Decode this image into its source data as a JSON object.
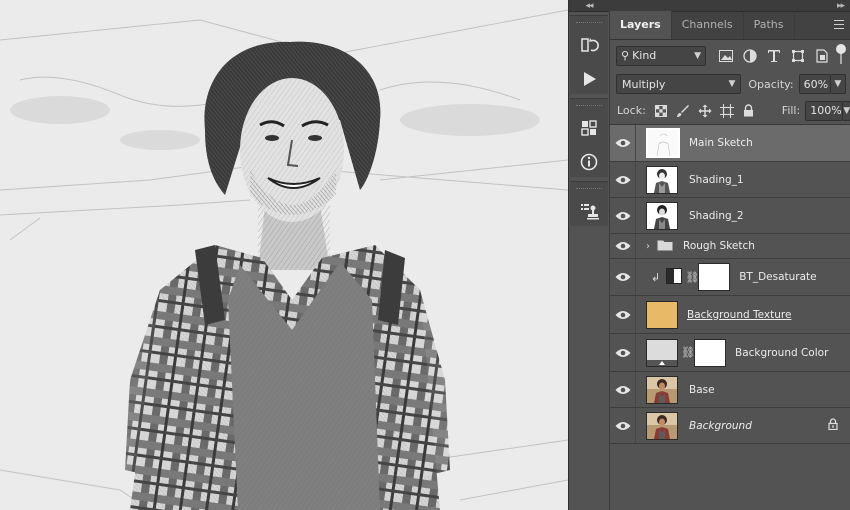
{
  "top_bar": {
    "collapse_glyph": "◂◂"
  },
  "tools": [
    {
      "name": "history-brush-icon"
    },
    {
      "name": "play-actions-icon"
    },
    {
      "name": "libraries-icon"
    },
    {
      "name": "info-icon"
    },
    {
      "name": "stamp-clone-icon"
    }
  ],
  "panel": {
    "collapse_glyph": "▸▸",
    "tabs": [
      {
        "label": "Layers",
        "active": true
      },
      {
        "label": "Channels",
        "active": false
      },
      {
        "label": "Paths",
        "active": false
      }
    ],
    "filter": {
      "label": "Kind",
      "search_glyph": "⚲"
    },
    "blend_mode": "Multiply",
    "opacity_label": "Opacity:",
    "opacity_value": "60%",
    "lock_label": "Lock:",
    "fill_label": "Fill:",
    "fill_value": "100%"
  },
  "layers": [
    {
      "name": "Main Sketch",
      "selected": true,
      "kind": "pixel-sketch",
      "italic": false,
      "underline": false
    },
    {
      "name": "Shading_1",
      "selected": false,
      "kind": "pixel-person",
      "italic": false,
      "underline": false
    },
    {
      "name": "Shading_2",
      "selected": false,
      "kind": "pixel-person",
      "italic": false,
      "underline": false
    },
    {
      "name": "Rough Sketch",
      "selected": false,
      "kind": "group",
      "italic": false,
      "underline": false
    },
    {
      "name": "BT_Desaturate",
      "selected": false,
      "kind": "adjustment",
      "italic": false,
      "underline": false
    },
    {
      "name": "Background Texture",
      "selected": false,
      "kind": "fill-color",
      "color": "#e8b967",
      "italic": false,
      "underline": true
    },
    {
      "name": "Background Color",
      "selected": false,
      "kind": "solid-color",
      "color": "#dcdcdc",
      "italic": false,
      "underline": false
    },
    {
      "name": "Base",
      "selected": false,
      "kind": "photo",
      "italic": false,
      "underline": false
    },
    {
      "name": "Background",
      "selected": false,
      "kind": "photo",
      "italic": true,
      "underline": false,
      "locked": true
    }
  ],
  "colors": {
    "panel_bg": "#535353",
    "selected_row": "#6b6b6b",
    "canvas_bg": "#e9e9e9"
  }
}
